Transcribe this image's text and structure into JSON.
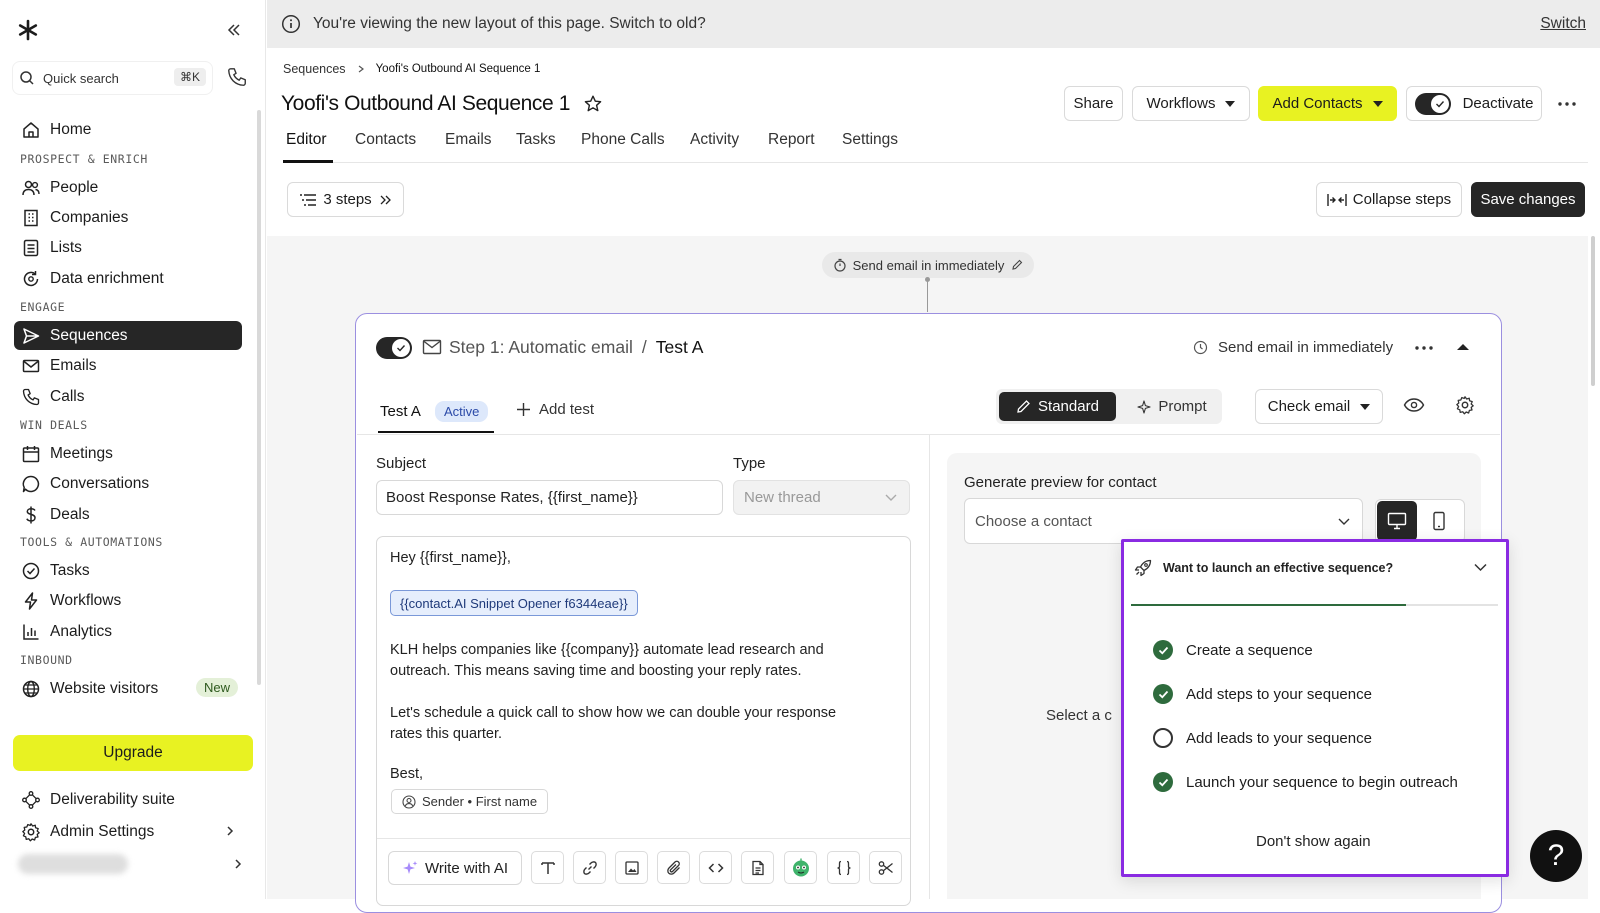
{
  "sidebar": {
    "search_label": "Quick search",
    "search_shortcut": "⌘K",
    "home": "Home",
    "section_prospect": "PROSPECT & ENRICH",
    "people": "People",
    "companies": "Companies",
    "lists": "Lists",
    "data_enrichment": "Data enrichment",
    "section_engage": "ENGAGE",
    "sequences": "Sequences",
    "emails": "Emails",
    "calls": "Calls",
    "section_win": "WIN DEALS",
    "meetings": "Meetings",
    "conversations": "Conversations",
    "deals": "Deals",
    "section_tools": "TOOLS & AUTOMATIONS",
    "tasks": "Tasks",
    "workflows": "Workflows",
    "analytics": "Analytics",
    "section_inbound": "INBOUND",
    "website_visitors": "Website visitors",
    "new_badge": "New",
    "upgrade": "Upgrade",
    "deliverability": "Deliverability suite",
    "admin_settings": "Admin Settings"
  },
  "banner": {
    "text": "You're viewing the new layout of this page. Switch to old?",
    "switch": "Switch"
  },
  "breadcrumb": {
    "root": "Sequences",
    "current": "Yoofi's Outbound AI Sequence 1"
  },
  "header": {
    "title": "Yoofi's Outbound AI Sequence 1",
    "share": "Share",
    "workflows": "Workflows",
    "add_contacts": "Add Contacts",
    "deactivate": "Deactivate"
  },
  "tabs": [
    "Editor",
    "Contacts",
    "Emails",
    "Tasks",
    "Phone Calls",
    "Activity",
    "Report",
    "Settings"
  ],
  "toolbar": {
    "steps": "3 steps",
    "collapse": "Collapse steps",
    "save": "Save changes"
  },
  "flow": {
    "trigger_pill": "Send email in immediately"
  },
  "step": {
    "title": "Step 1: Automatic email",
    "separator": "/",
    "variant": "Test A",
    "timing": "Send email in immediately",
    "test_tab": "Test A",
    "active_badge": "Active",
    "add_test": "Add test",
    "mode_standard": "Standard",
    "mode_prompt": "Prompt",
    "check_email": "Check email"
  },
  "editor": {
    "subject_label": "Subject",
    "subject_value": "Boost Response Rates, {{first_name}}",
    "type_label": "Type",
    "type_value": "New thread",
    "greeting": "Hey {{first_name}},",
    "snippet": "{{contact.AI Snippet Opener f6344eae}}",
    "para1_line1": "KLH helps companies like {{company}} automate lead research and",
    "para1_line2": "outreach. This means saving time and boosting your reply rates.",
    "para2_line1": "Let's schedule a quick call to show how we can double your response",
    "para2_line2": "rates this quarter.",
    "signoff": "Best,",
    "sender_chip": "Sender • First name",
    "write_ai": "Write with AI"
  },
  "preview": {
    "label": "Generate preview for contact",
    "placeholder": "Choose a contact",
    "select_text": "Select a c"
  },
  "checklist": {
    "title": "Want to launch an effective sequence?",
    "progress": 0.75,
    "items": [
      {
        "label": "Create a sequence",
        "done": true
      },
      {
        "label": "Add steps to your sequence",
        "done": true
      },
      {
        "label": "Add leads to your sequence",
        "done": false
      },
      {
        "label": "Launch your sequence to begin outreach",
        "done": true
      }
    ],
    "dismiss": "Don't show again"
  },
  "help": "?",
  "colors": {
    "accent_yellow": "#e8f222",
    "dark": "#262626",
    "success_green": "#2e6b3d",
    "highlight_purple": "#8a2be2",
    "step_border": "#9b8fe0",
    "badge_blue_bg": "#dde8fb"
  }
}
